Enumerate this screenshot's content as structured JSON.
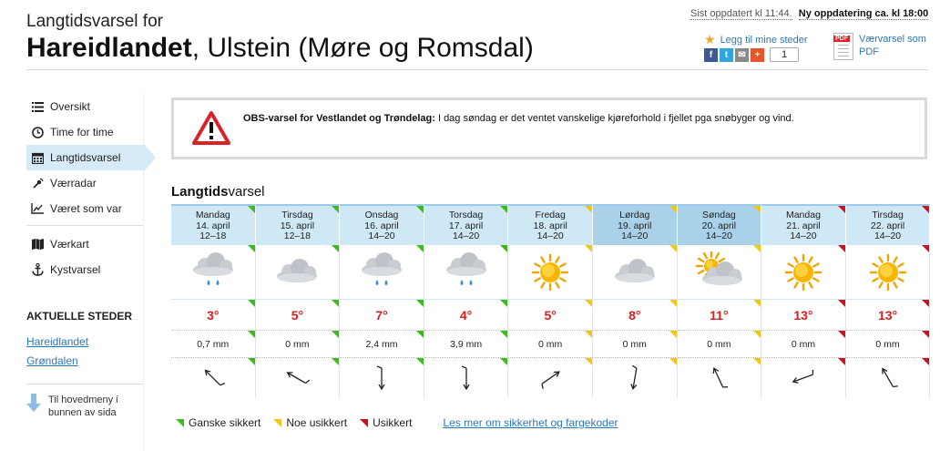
{
  "header": {
    "subtitle": "Langtidsvarsel for",
    "place_bold": "Hareidlandet",
    "place_rest": ", Ulstein (Møre og Romsdal)",
    "last_updated": "Sist oppdatert kl 11:44.",
    "next_update": "Ny oppdatering ca. kl 18:00",
    "favorite": "Legg til mine steder",
    "share_count": "1",
    "pdf": "Værvarsel som PDF"
  },
  "sidebar": {
    "items": [
      {
        "label": "Oversikt",
        "icon": "list-icon"
      },
      {
        "label": "Time for time",
        "icon": "clock-icon"
      },
      {
        "label": "Langtidsvarsel",
        "icon": "calendar-icon"
      },
      {
        "label": "Værradar",
        "icon": "radar-icon"
      },
      {
        "label": "Været som var",
        "icon": "chart-icon"
      },
      {
        "label": "Værkart",
        "icon": "map-icon"
      },
      {
        "label": "Kystvarsel",
        "icon": "anchor-icon"
      }
    ],
    "places_heading": "AKTUELLE STEDER",
    "places": [
      "Hareidlandet",
      "Grøndalen"
    ],
    "to_menu": "Til hovedmeny i bunnen av sida"
  },
  "alert": {
    "title": "OBS-varsel for Vestlandet og Trøndelag:",
    "text": "I dag søndag er det ventet vanskelige kjøreforhold i fjellet pga snøbyger og vind."
  },
  "forecast": {
    "heading_bold": "Langtids",
    "heading_rest": "varsel",
    "days": [
      {
        "day": "Mandag",
        "date": "14. april",
        "time": "12–18",
        "symbol": "cloud-rain-icon",
        "temp": "3°",
        "precip": "0,7 mm",
        "wind_deg": 135,
        "certainty": "green"
      },
      {
        "day": "Tirsdag",
        "date": "15. april",
        "time": "12–18",
        "symbol": "cloud-icon",
        "temp": "5°",
        "precip": "0 mm",
        "wind_deg": 120,
        "certainty": "green"
      },
      {
        "day": "Onsdag",
        "date": "16. april",
        "time": "14–20",
        "symbol": "cloud-rain-icon",
        "temp": "7°",
        "precip": "2,4 mm",
        "wind_deg": 0,
        "certainty": "green"
      },
      {
        "day": "Torsdag",
        "date": "17. april",
        "time": "14–20",
        "symbol": "cloud-rain-icon",
        "temp": "4°",
        "precip": "3,9 mm",
        "wind_deg": 0,
        "certainty": "green"
      },
      {
        "day": "Fredag",
        "date": "18. april",
        "time": "14–20",
        "symbol": "sun-icon",
        "temp": "5°",
        "precip": "0 mm",
        "wind_deg": 235,
        "certainty": "yellow"
      },
      {
        "day": "Lørdag",
        "date": "19. april",
        "time": "14–20",
        "symbol": "cloud-icon",
        "temp": "8°",
        "precip": "0 mm",
        "wind_deg": 10,
        "certainty": "yellow",
        "weekend": true
      },
      {
        "day": "Søndag",
        "date": "20. april",
        "time": "14–20",
        "symbol": "partly-cloudy-icon",
        "temp": "11°",
        "precip": "0 mm",
        "wind_deg": 155,
        "certainty": "yellow",
        "weekend": true
      },
      {
        "day": "Mandag",
        "date": "21. april",
        "time": "14–20",
        "symbol": "sun-icon",
        "temp": "13°",
        "precip": "0 mm",
        "wind_deg": 70,
        "certainty": "red"
      },
      {
        "day": "Tirsdag",
        "date": "22. april",
        "time": "14–20",
        "symbol": "sun-icon",
        "temp": "13°",
        "precip": "0 mm",
        "wind_deg": 150,
        "certainty": "red"
      }
    ]
  },
  "legend": {
    "items": [
      {
        "label": "Ganske sikkert",
        "color": "green"
      },
      {
        "label": "Noe usikkert",
        "color": "yellow"
      },
      {
        "label": "Usikkert",
        "color": "red"
      }
    ],
    "link": "Les mer om sikkerhet og fargekoder"
  },
  "colors": {
    "green": "#3dbb1d",
    "yellow": "#f2c519",
    "red": "#c8141e",
    "temp": "#d81e1e",
    "link": "#2a78b8"
  }
}
